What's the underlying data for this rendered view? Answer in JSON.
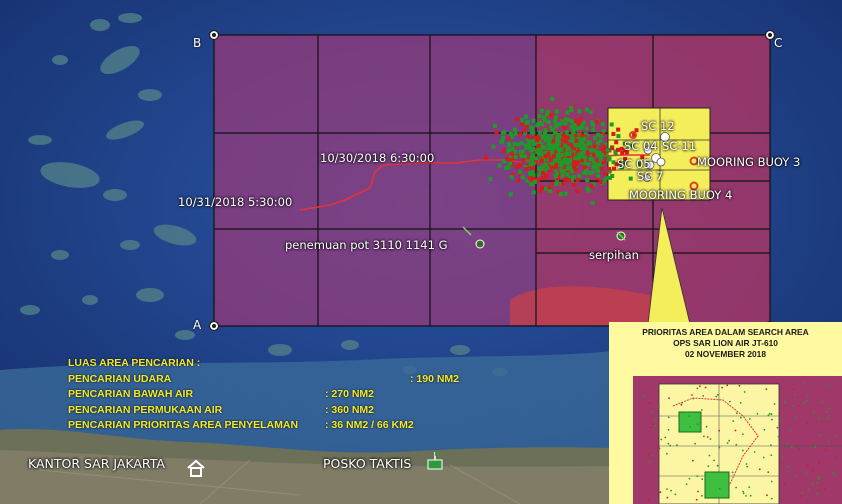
{
  "corners": {
    "a": "A",
    "b": "B",
    "c": "C"
  },
  "labels": {
    "time_1": "10/30/2018 6:30:00",
    "time_2": "10/31/2018 5:30:00",
    "pot_find": "penemuan pot 3110 1141 G",
    "debris": "serpihan",
    "sc12": "SC 12",
    "sc04": "SC 04",
    "sc11": "SC-11",
    "sc05": "SC 05",
    "sc7": "SC 7",
    "buoy3": "MOORING BUOY 3",
    "buoy4": "MOORING BUOY 4",
    "kantor": "KANTOR SAR JAKARTA",
    "posko": "POSKO TAKTIS"
  },
  "info": {
    "heading": "LUAS AREA PENCARIAN :",
    "rows": [
      {
        "label": "PENCARIAN UDARA",
        "value": ": 190 NM2"
      },
      {
        "label": "PENCARIAN BAWAH AIR",
        "value": ": 270 NM2"
      },
      {
        "label": "PENCARIAN PERMUKAAN AIR",
        "value": ": 360 NM2"
      },
      {
        "label": "PENCARIAN PRIORITAS AREA PENYELAMAN",
        "value": ": 36 NM2 / 66 KM2"
      }
    ]
  },
  "inset": {
    "line1": "PRIORITAS AREA DALAM SEARCH AREA",
    "line2": "OPS SAR LION AIR JT-610",
    "line3": "02 NOVEMBER 2018"
  },
  "colors": {
    "sea": "#1f3f86",
    "search_area": "#9b3a7a",
    "priority_area": "#f4ee5a",
    "highlight": "#f2ea2a",
    "dot_red": "#d41c1c",
    "dot_green": "#1f9a2a",
    "track": "#e0343c"
  },
  "icons": [
    "home-icon",
    "flag-icon",
    "waypoint-icon",
    "buoy-icon"
  ]
}
